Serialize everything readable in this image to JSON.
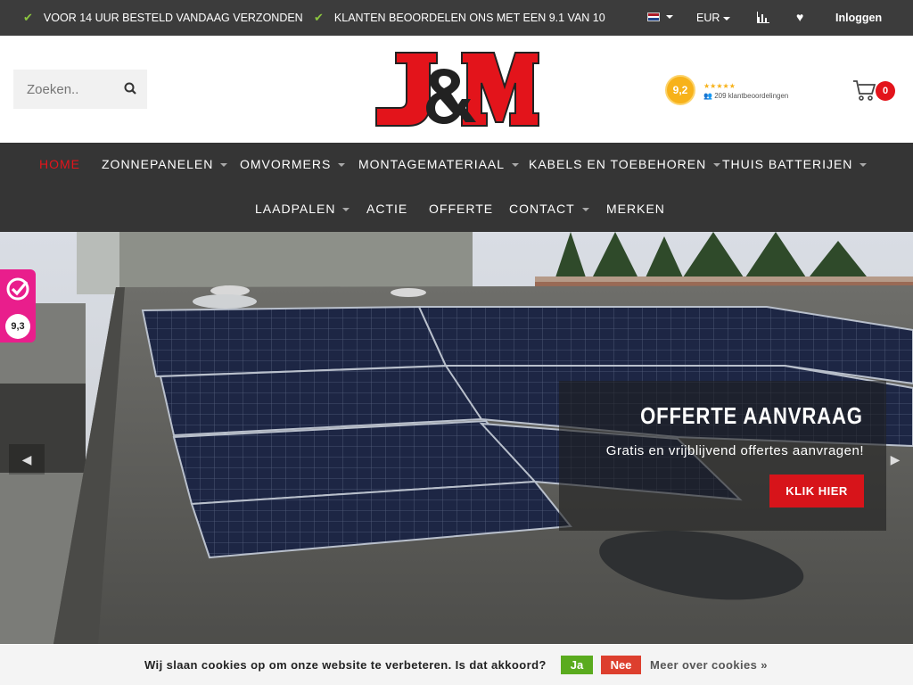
{
  "topbar": {
    "usps": [
      "VOOR 14 UUR BESTELD VANDAAG VERZONDEN",
      "KLANTEN BEOORDELEN ONS MET EEN 9.1 VAN 10"
    ],
    "currency": "EUR",
    "login": "Inloggen"
  },
  "header": {
    "search_placeholder": "Zoeken..",
    "logo_text": "J&M",
    "rating": {
      "score": "9,2",
      "stars": 5,
      "reviews": "209 klantbeoordelingen"
    },
    "cart_count": "0"
  },
  "nav": {
    "items": [
      {
        "label": "HOME",
        "active": true,
        "dropdown": false
      },
      {
        "label": "ZONNEPANELEN",
        "dropdown": true
      },
      {
        "label": "OMVORMERS",
        "dropdown": true
      },
      {
        "label": "MONTAGEMATERIAAL",
        "dropdown": true
      },
      {
        "label": "KABELS EN TOEBEHOREN",
        "dropdown": true
      },
      {
        "label": "THUIS BATTERIJEN",
        "dropdown": true
      },
      {
        "label": "LAADPALEN",
        "dropdown": true
      },
      {
        "label": "ACTIE",
        "dropdown": false
      },
      {
        "label": "OFFERTE",
        "dropdown": false
      },
      {
        "label": "CONTACT",
        "dropdown": true
      },
      {
        "label": "MERKEN",
        "dropdown": false
      }
    ]
  },
  "hero": {
    "title": "OFFERTE AANVRAAG",
    "subtitle": "Gratis en vrijblijvend offertes aanvragen!",
    "button": "KLIK HIER"
  },
  "kiyoh": {
    "score": "9,3"
  },
  "cookie": {
    "message": "Wij slaan cookies op om onze website te verbeteren. Is dat akkoord?",
    "yes": "Ja",
    "no": "Nee",
    "more": "Meer over cookies »"
  },
  "colors": {
    "accent": "#e3141b",
    "topbar": "#3c3c3c",
    "nav": "#353535",
    "check": "#8cc63f",
    "kiyoh": "#e91e8c"
  }
}
